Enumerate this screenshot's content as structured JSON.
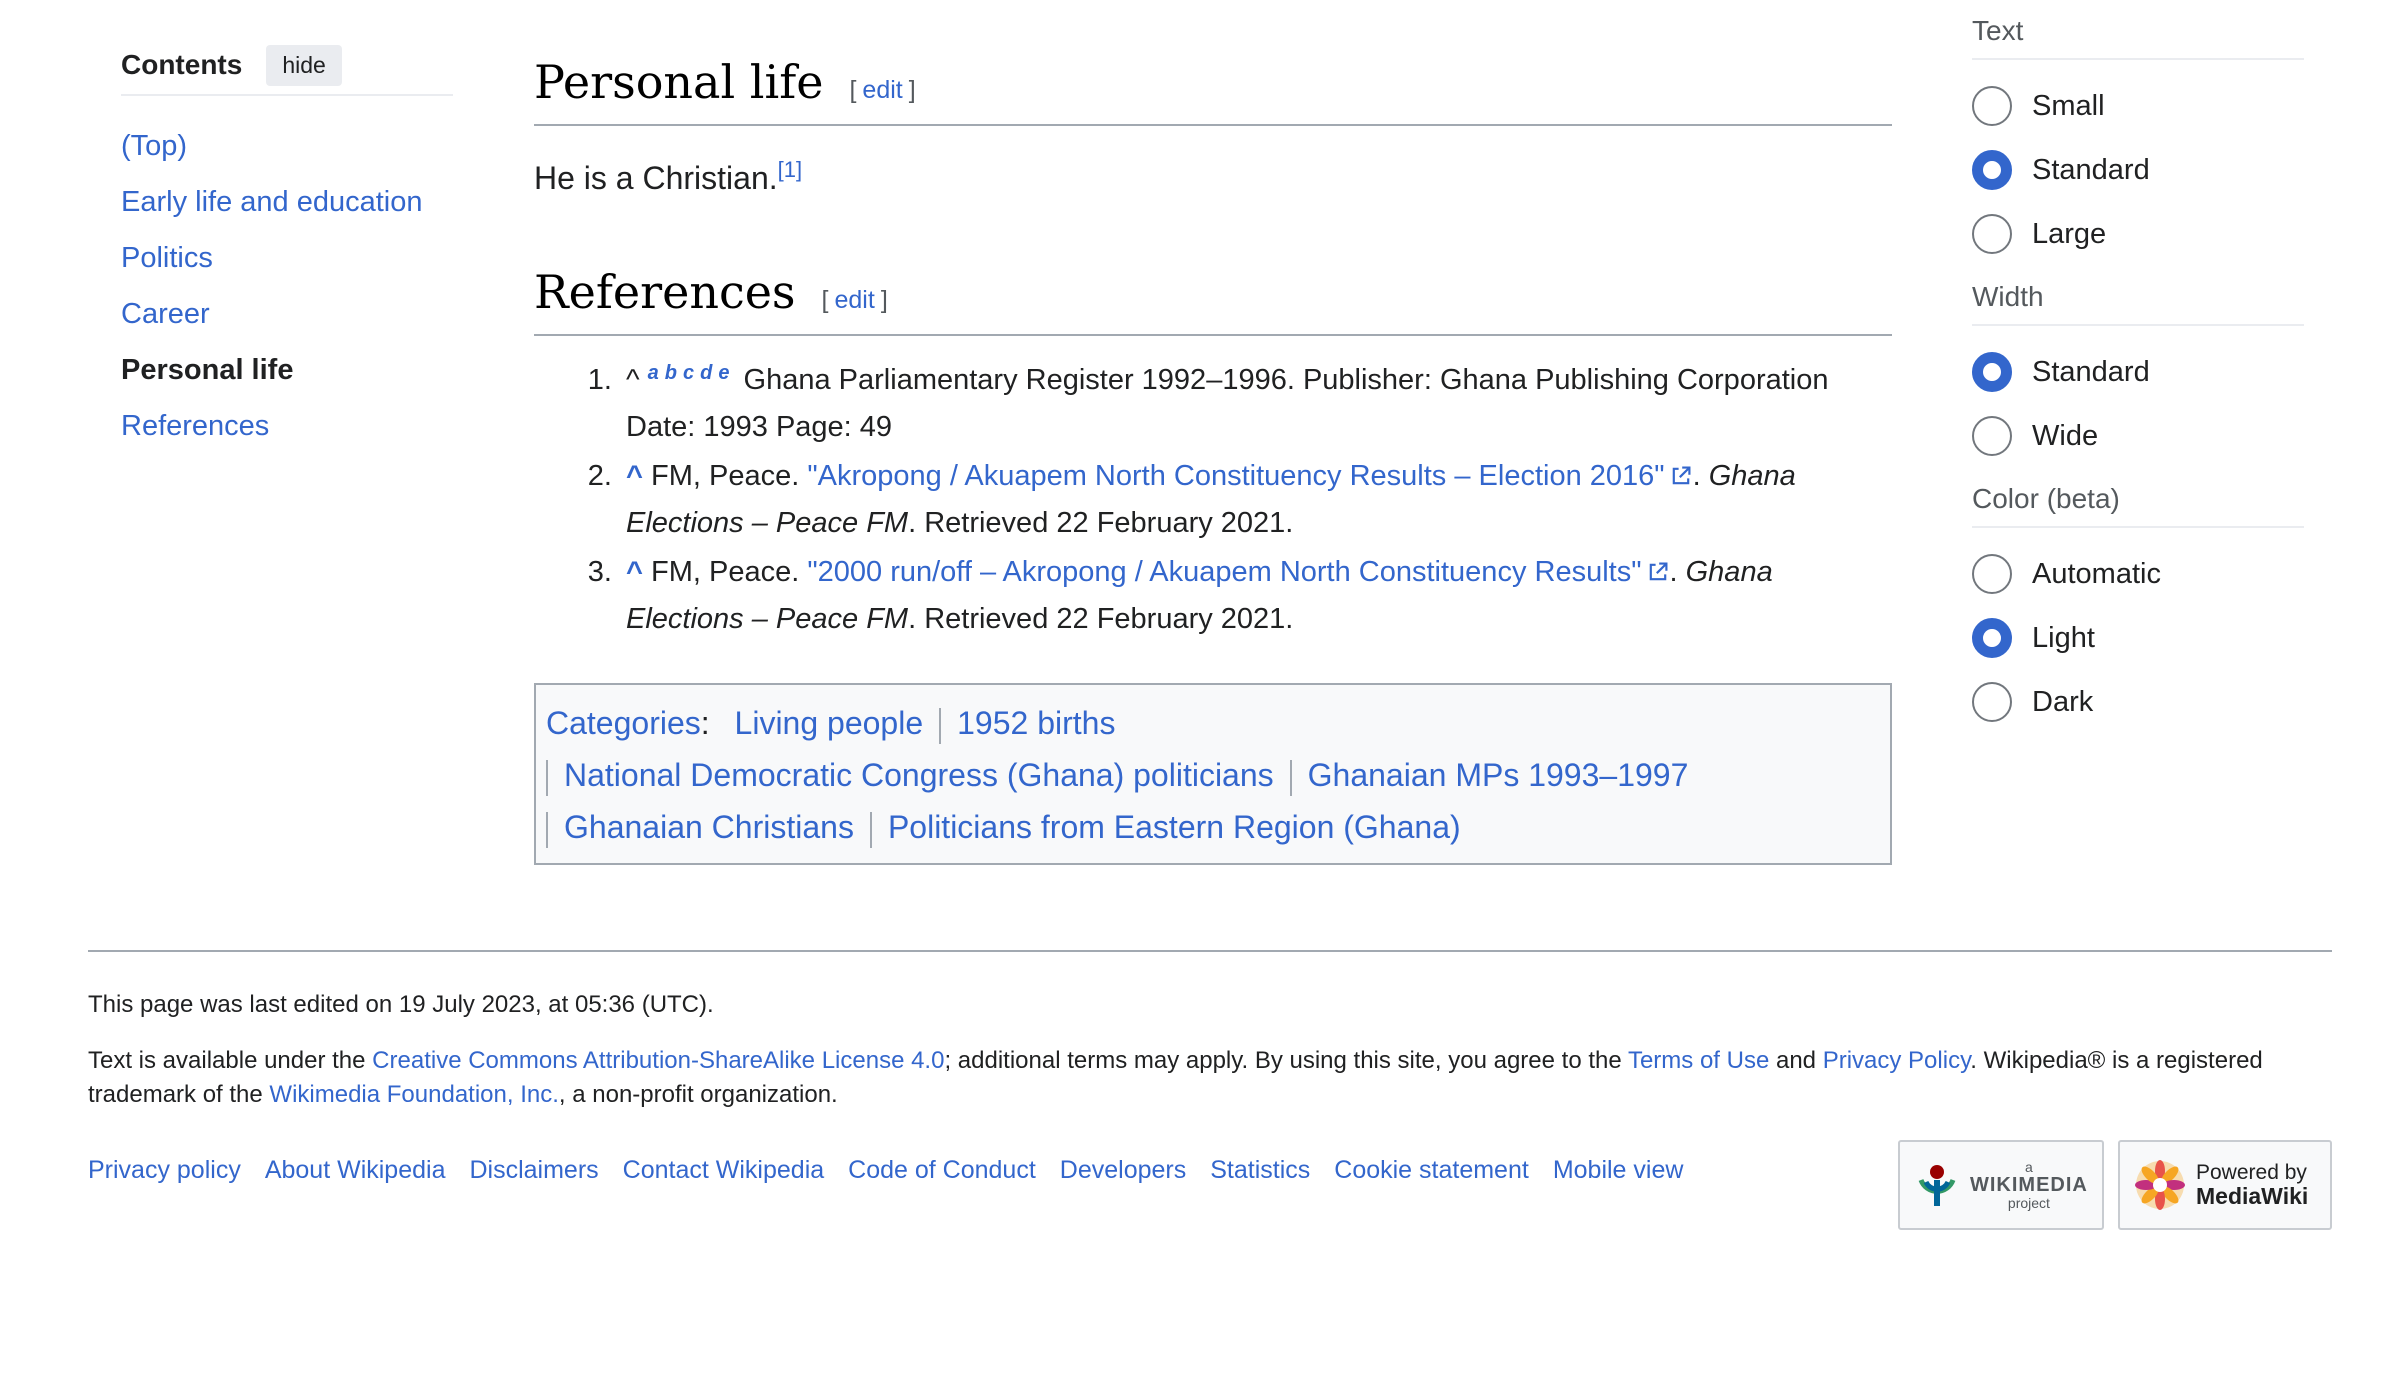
{
  "toc": {
    "title": "Contents",
    "hide_label": "hide",
    "items": [
      {
        "label": "(Top)"
      },
      {
        "label": "Early life and education"
      },
      {
        "label": "Politics"
      },
      {
        "label": "Career"
      },
      {
        "label": "Personal life",
        "active": true
      },
      {
        "label": "References"
      }
    ]
  },
  "content": {
    "personal_life": {
      "heading": "Personal life",
      "edit_open": "[",
      "edit_label": "edit",
      "edit_close": "]",
      "text": "He is a Christian.",
      "ref_mark": "[1]"
    },
    "references": {
      "heading": "References",
      "edit_label": "edit",
      "items": [
        {
          "caret": "^",
          "backlinks": [
            "a",
            "b",
            "c",
            "d",
            "e"
          ],
          "text": "Ghana Parliamentary Register 1992–1996. Publisher: Ghana Publishing Corporation Date: 1993 Page: 49"
        },
        {
          "caret": "^",
          "author": "FM, Peace.",
          "link": "\"Akropong / Akuapem North Constituency Results – Election 2016\"",
          "work": "Ghana Elections – Peace FM",
          "retrieved": "Retrieved 22 February 2021."
        },
        {
          "caret": "^",
          "author": "FM, Peace.",
          "link": "\"2000 run/off – Akropong / Akuapem North Constituency Results\"",
          "work": "Ghana Elections – Peace FM",
          "retrieved": "Retrieved 22 February 2021."
        }
      ]
    },
    "categories": {
      "label": "Categories",
      "items": [
        "Living people",
        "1952 births",
        "National Democratic Congress (Ghana) politicians",
        "Ghanaian MPs 1993–1997",
        "Ghanaian Christians",
        "Politicians from Eastern Region (Ghana)"
      ]
    }
  },
  "appearance": {
    "text": {
      "title": "Text",
      "options": [
        {
          "label": "Small",
          "checked": false
        },
        {
          "label": "Standard",
          "checked": true
        },
        {
          "label": "Large",
          "checked": false
        }
      ]
    },
    "width": {
      "title": "Width",
      "options": [
        {
          "label": "Standard",
          "checked": true
        },
        {
          "label": "Wide",
          "checked": false
        }
      ]
    },
    "color": {
      "title": "Color (beta)",
      "options": [
        {
          "label": "Automatic",
          "checked": false
        },
        {
          "label": "Light",
          "checked": true
        },
        {
          "label": "Dark",
          "checked": false
        }
      ]
    }
  },
  "footer": {
    "last_edited": "This page was last edited on 19 July 2023, at 05:36 (UTC).",
    "license_pre": "Text is available under the ",
    "license_link": "Creative Commons Attribution-ShareAlike License 4.0",
    "license_mid": "; additional terms may apply. By using this site, you agree to the ",
    "terms_link": "Terms of Use",
    "and": " and ",
    "privacy_link": "Privacy Policy",
    "license_post": ". Wikipedia® is a registered trademark of the ",
    "foundation_link": "Wikimedia Foundation, Inc.",
    "license_end": ", a non-profit organization.",
    "places": [
      "Privacy policy",
      "About Wikipedia",
      "Disclaimers",
      "Contact Wikipedia",
      "Code of Conduct",
      "Developers",
      "Statistics",
      "Cookie statement",
      "Mobile view"
    ],
    "wikimedia_badge": {
      "small": "a",
      "big": "WIKIMEDIA",
      "small2": "project"
    },
    "mediawiki_badge": {
      "line1": "Powered by",
      "line2": "MediaWiki"
    }
  },
  "colors": {
    "link": "#3366cc",
    "text": "#202122",
    "border": "#a2a9b1",
    "radio_checked": "#3366cc"
  }
}
